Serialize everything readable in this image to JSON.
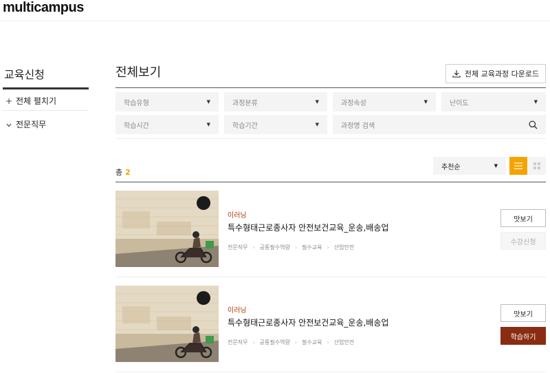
{
  "header": {
    "logo_text": "multicampus"
  },
  "sidebar": {
    "title": "교육신청",
    "items": [
      {
        "icon": "plus-icon",
        "label": "전체 펼치기"
      },
      {
        "icon": "chevron-down-icon",
        "label": "전문직무"
      }
    ]
  },
  "main": {
    "title": "전체보기",
    "download_label": "전체 교육과정 다운로드",
    "filters": [
      {
        "label": "학습유형"
      },
      {
        "label": "과정분류"
      },
      {
        "label": "과정속성"
      },
      {
        "label": "난이도"
      },
      {
        "label": "학습시간"
      },
      {
        "label": "학습기간"
      }
    ],
    "search": {
      "placeholder": "과정명 검색"
    },
    "total_label": "총",
    "total_count": "2",
    "sort": {
      "selected": "추천순"
    },
    "colors": {
      "accent": "#f5a300",
      "learn_button": "#8a2c12",
      "type_text": "#b23a00"
    }
  },
  "courses": [
    {
      "type": "이러닝",
      "title": "특수형태근로종사자 안전보건교육_운송,배송업",
      "tags": [
        "전문직무",
        "공통필수역량",
        "필수교육",
        "산업안전"
      ],
      "buttons": {
        "preview": "맛보기",
        "action": "수강신청",
        "action_state": "disabled"
      }
    },
    {
      "type": "이러닝",
      "title": "특수형태근로종사자 안전보건교육_운송,배송업",
      "tags": [
        "전문직무",
        "공통필수역량",
        "필수교육",
        "산업안전"
      ],
      "buttons": {
        "preview": "맛보기",
        "action": "학습하기",
        "action_state": "active"
      }
    }
  ]
}
